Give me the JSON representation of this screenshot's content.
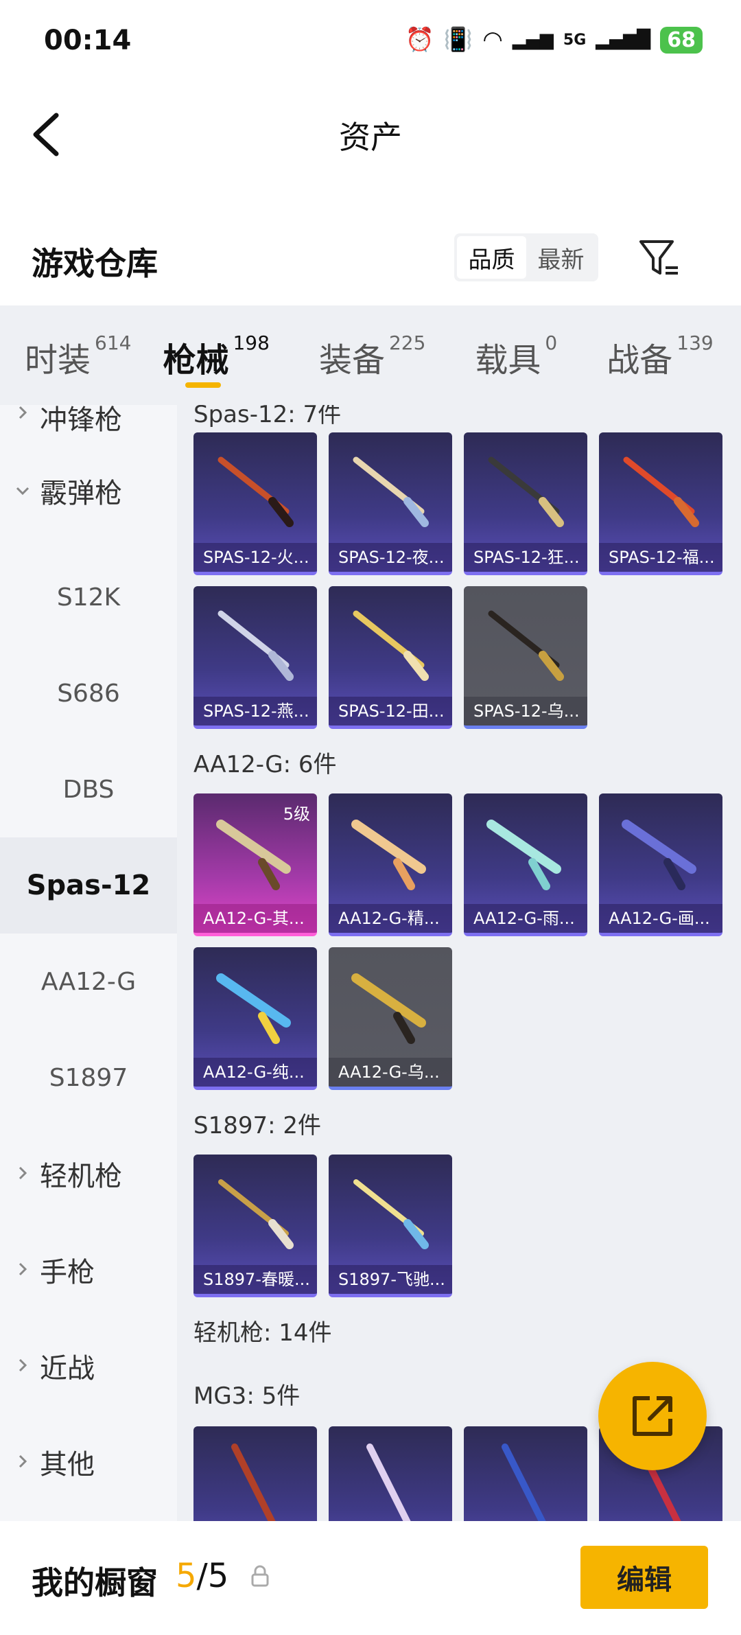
{
  "status_bar": {
    "time": "00:14",
    "signal_label": "5G",
    "battery": "68"
  },
  "header": {
    "title": "资产"
  },
  "warehouse": {
    "title": "游戏仓库",
    "sort_options": [
      {
        "label": "品质",
        "active": true
      },
      {
        "label": "最新",
        "active": false
      }
    ]
  },
  "tabs": [
    {
      "label": "时装",
      "count": "614"
    },
    {
      "label": "枪械",
      "count": "198"
    },
    {
      "label": "装备",
      "count": "225"
    },
    {
      "label": "载具",
      "count": "0"
    },
    {
      "label": "战备",
      "count": "139"
    }
  ],
  "sidebar": {
    "groups": [
      "冲锋枪",
      "霰弹枪",
      "轻机枪",
      "手枪",
      "近战",
      "其他"
    ],
    "shotgun_subs": [
      "S12K",
      "S686",
      "DBS",
      "Spas-12",
      "AA12-G",
      "S1897"
    ],
    "selected": "Spas-12"
  },
  "sections": {
    "spas_title": "Spas-12: 7件",
    "spas_items": [
      "SPAS-12-火...",
      "SPAS-12-夜...",
      "SPAS-12-狂...",
      "SPAS-12-福...",
      "SPAS-12-燕...",
      "SPAS-12-田...",
      "SPAS-12-乌..."
    ],
    "aa12_title": "AA12-G: 6件",
    "aa12_items": [
      "AA12-G-其...",
      "AA12-G-精...",
      "AA12-G-雨...",
      "AA12-G-画...",
      "AA12-G-纯...",
      "AA12-G-乌..."
    ],
    "aa12_level": "5级",
    "s1897_title": "S1897: 2件",
    "s1897_items": [
      "S1897-春暖...",
      "S1897-飞驰..."
    ],
    "lmg_title": "轻机枪: 14件",
    "mg3_title": "MG3: 5件"
  },
  "bottom": {
    "label": "我的橱窗",
    "current": "5",
    "separator": "/",
    "total": "5",
    "edit_label": "编辑"
  },
  "colors": {
    "accent": "#f6b400",
    "card_purple": "#3f3a86",
    "card_pink": "#a33aa8",
    "card_grey": "#5a5b64"
  }
}
